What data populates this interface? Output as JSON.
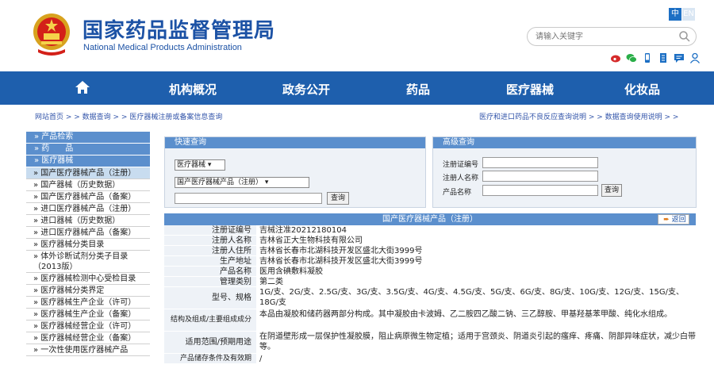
{
  "header": {
    "title_cn": "国家药品监督管理局",
    "title_en": "National Medical Products Administration",
    "lang_cn": "中",
    "lang_en": "EN",
    "search_placeholder": "请输入关键字"
  },
  "nav": {
    "items": [
      "机构概况",
      "政务公开",
      "药品",
      "医疗器械",
      "化妆品"
    ]
  },
  "breadcrumb": {
    "left": "网站首页 > > 数据查询 > > 医疗器械注册或备案信息查询",
    "right": "医疗和进口药品不良反应查询说明 > >    数据查询使用说明 > >"
  },
  "sidebar": {
    "heads": [
      "» 产品检索",
      "» 药　　品",
      "» 医疗器械"
    ],
    "items": [
      "国产医疗器械产品（注册）",
      "国产器械（历史数据）",
      "国产医疗器械产品（备案）",
      "进口医疗器械产品（注册）",
      "进口器械（历史数据）",
      "进口医疗器械产品（备案）",
      "医疗器械分类目录",
      "体外诊断试剂分类子目录（2013版）",
      "医疗器械检测中心受检目录",
      "医疗器械分类界定",
      "医疗器械生产企业（许可）",
      "医疗器械生产企业（备案）",
      "医疗器械经营企业（许可）",
      "医疗器械经营企业（备案）",
      "一次性使用医疗器械产品"
    ]
  },
  "quick": {
    "title": "快速查询",
    "select1": "医疗器械",
    "select2": "国产医疗器械产品（注册）",
    "button": "查询"
  },
  "advanced": {
    "title": "高级查询",
    "labels": [
      "注册证编号",
      "注册人名称",
      "产品名称"
    ],
    "button": "查询"
  },
  "detail": {
    "title": "国产医疗器械产品（注册）",
    "back": "返回",
    "rows": [
      {
        "k": "注册证编号",
        "v": "吉械注准20212180104"
      },
      {
        "k": "注册人名称",
        "v": "吉林省正大生物科技有限公司"
      },
      {
        "k": "注册人住所",
        "v": "吉林省长春市北湖科技开发区盛北大街3999号"
      },
      {
        "k": "生产地址",
        "v": "吉林省长春市北湖科技开发区盛北大街3999号"
      },
      {
        "k": "产品名称",
        "v": "医用含碘敷料凝胶"
      },
      {
        "k": "管理类别",
        "v": "第二类"
      },
      {
        "k": "型号、规格",
        "v": "1G/支、2G/支、2.5G/支、3G/支、3.5G/支、4G/支、4.5G/支、5G/支、6G/支、8G/支、10G/支、12G/支、15G/支、18G/支"
      },
      {
        "k": "结构及组成/主要组成成分",
        "v": "本品由凝胶和储药器两部分构成。其中凝胶由卡波姆、乙二胺四乙酸二钠、三乙醇胺、甲基羟基苯甲酸、纯化水组成。"
      },
      {
        "k": "适用范围/预期用途",
        "v": "在阴道壁形成一层保护性凝胶膜，阻止病原微生物定植；适用于宫颈炎、阴道炎引起的瘙痒、疼痛、阴部异味症状，减少白带等。"
      },
      {
        "k": "产品储存条件及有效期",
        "v": "/"
      }
    ]
  }
}
